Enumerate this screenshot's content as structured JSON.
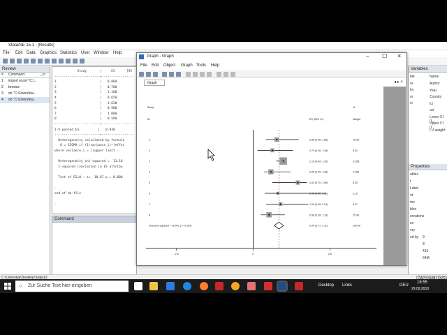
{
  "stata": {
    "title": "Stata/SE 15.1 - [Results]",
    "menu": [
      "File",
      "Edit",
      "Data",
      "Graphics",
      "Statistics",
      "User",
      "Window",
      "Help"
    ],
    "review": {
      "header": "Review",
      "col1": "#",
      "col2": "Command",
      "col3": "_rc",
      "items": [
        {
          "n": "1",
          "cmd": "import excel \"C:\\..."
        },
        {
          "n": "2",
          "cmd": "browse"
        },
        {
          "n": "3",
          "cmd": "do \"C:\\Users\\kai..."
        },
        {
          "n": "4",
          "cmd": "do \"C:\\Users\\kai..."
        }
      ]
    },
    "results_lines": [
      "            Study       |     ES      [95",
      "------------------------+-----------------",
      "1                       |   0.860",
      "2                       |   0.700",
      "3                       |   1.100",
      "4                       |   0.650",
      "5                       |   1.630",
      "6                       |   0.900",
      "7                       |   1.000",
      "8                       |   0.580",
      "------------------------+-----------------",
      "I-V pooled ES          |   0.938",
      "------------------------+-----------------",
      "  Heterogeneity calculated by formula",
      "   Q = SIGMA_i{ (1/variance_i)*(effec",
      "where variance_i = ((upper limit - ",
      "",
      "  Heterogeneity chi-squared =  11.18",
      "  I-squared (variation in ES attribu",
      "",
      "  Test of ES=0 : z=  10.67 p = 0.000",
      "",
      ".",
      "end of do-file",
      "",
      "."
    ],
    "command_header": "Command",
    "vars_header": "Variables",
    "vars_name_col": "Name",
    "vars": [
      "Author",
      "Year",
      "Country",
      "lci",
      "uci",
      "Lower CI (I...",
      "Upper CI (I...",
      "I-V weight"
    ],
    "vars_partial": [
      "ble",
      "or",
      "try",
      "or",
      "ci"
    ],
    "props_header": "Properties",
    "props": [
      "ables",
      "t",
      "Label",
      "ot",
      "me",
      "bles",
      "ervations",
      "ze",
      "ory",
      "ed by"
    ],
    "props_vals": [
      "9",
      "8",
      "416",
      "64M"
    ],
    "status_path": "C:\\Users\\kai\\Desktop\\Stata13",
    "indicators": [
      "CAP",
      "NUM",
      "OVR"
    ]
  },
  "graph": {
    "title": "Graph - Graph",
    "menu": [
      "File",
      "Edit",
      "Object",
      "Graph",
      "Tools",
      "Help"
    ],
    "tab": "Graph"
  },
  "chart_data": {
    "type": "forest",
    "header_study": "Study",
    "header_id": "ID",
    "header_es": "ES (95% CI)",
    "header_pct": "%",
    "header_weight": "Weight",
    "studies": [
      {
        "id": "1",
        "es": 0.86,
        "lci": 0.46,
        "uci": 1.66,
        "label": "0.86 (0.46, 1.66)",
        "weight": "10.18"
      },
      {
        "id": "2",
        "es": 0.7,
        "lci": 0.16,
        "uci": 1.45,
        "label": "0.70 (0.16, 1.45)",
        "weight": "6.52"
      },
      {
        "id": "3",
        "es": 1.1,
        "lci": 0.84,
        "uci": 1.2,
        "label": "1.10 (0.84, 1.20)",
        "weight": "37.88"
      },
      {
        "id": "4",
        "es": 0.65,
        "lci": 0.4,
        "uci": 1.36,
        "label": "0.65 (0.40, 1.36)",
        "weight": "14.66"
      },
      {
        "id": "5",
        "es": 1.63,
        "lci": 0.7,
        "uci": 1.96,
        "label": "1.63 (0.70, 1.96)",
        "weight": "8.25"
      },
      {
        "id": "6",
        "es": 0.9,
        "lci": 0.42,
        "uci": 2.66,
        "label": "0.90 (0.42, 2.66)",
        "weight": "2.10"
      },
      {
        "id": "7",
        "es": 1.0,
        "lci": 0.48,
        "uci": 2.01,
        "label": "1.00 (0.48, 2.01)",
        "weight": "5.07"
      },
      {
        "id": "8",
        "es": 0.58,
        "lci": 0.28,
        "uci": 1.16,
        "label": "0.58 (0.28, 1.16)",
        "weight": "15.34"
      }
    ],
    "overall": {
      "label": "Overall  (I-squared = 20.9%, p = 0.134)",
      "es": 0.94,
      "lci": 0.77,
      "uci": 1.11,
      "es_label": "0.94 (0.77, 1.11)",
      "weight": "100.00"
    },
    "xticks": [
      "-2.8",
      "0",
      "2.8"
    ],
    "xlim": [
      -3.4,
      4.5
    ]
  },
  "taskbar": {
    "search": "Zur Suche Text hier eingeben",
    "desktop": "Desktop",
    "links": "Links",
    "lang": "DEU",
    "time": "18:55",
    "date": "29.09.2018"
  },
  "colors": {
    "stata_blue": "#1f4e8c",
    "graph_gray": "#9a9a9a",
    "taskbar": "#1b1b1b"
  }
}
